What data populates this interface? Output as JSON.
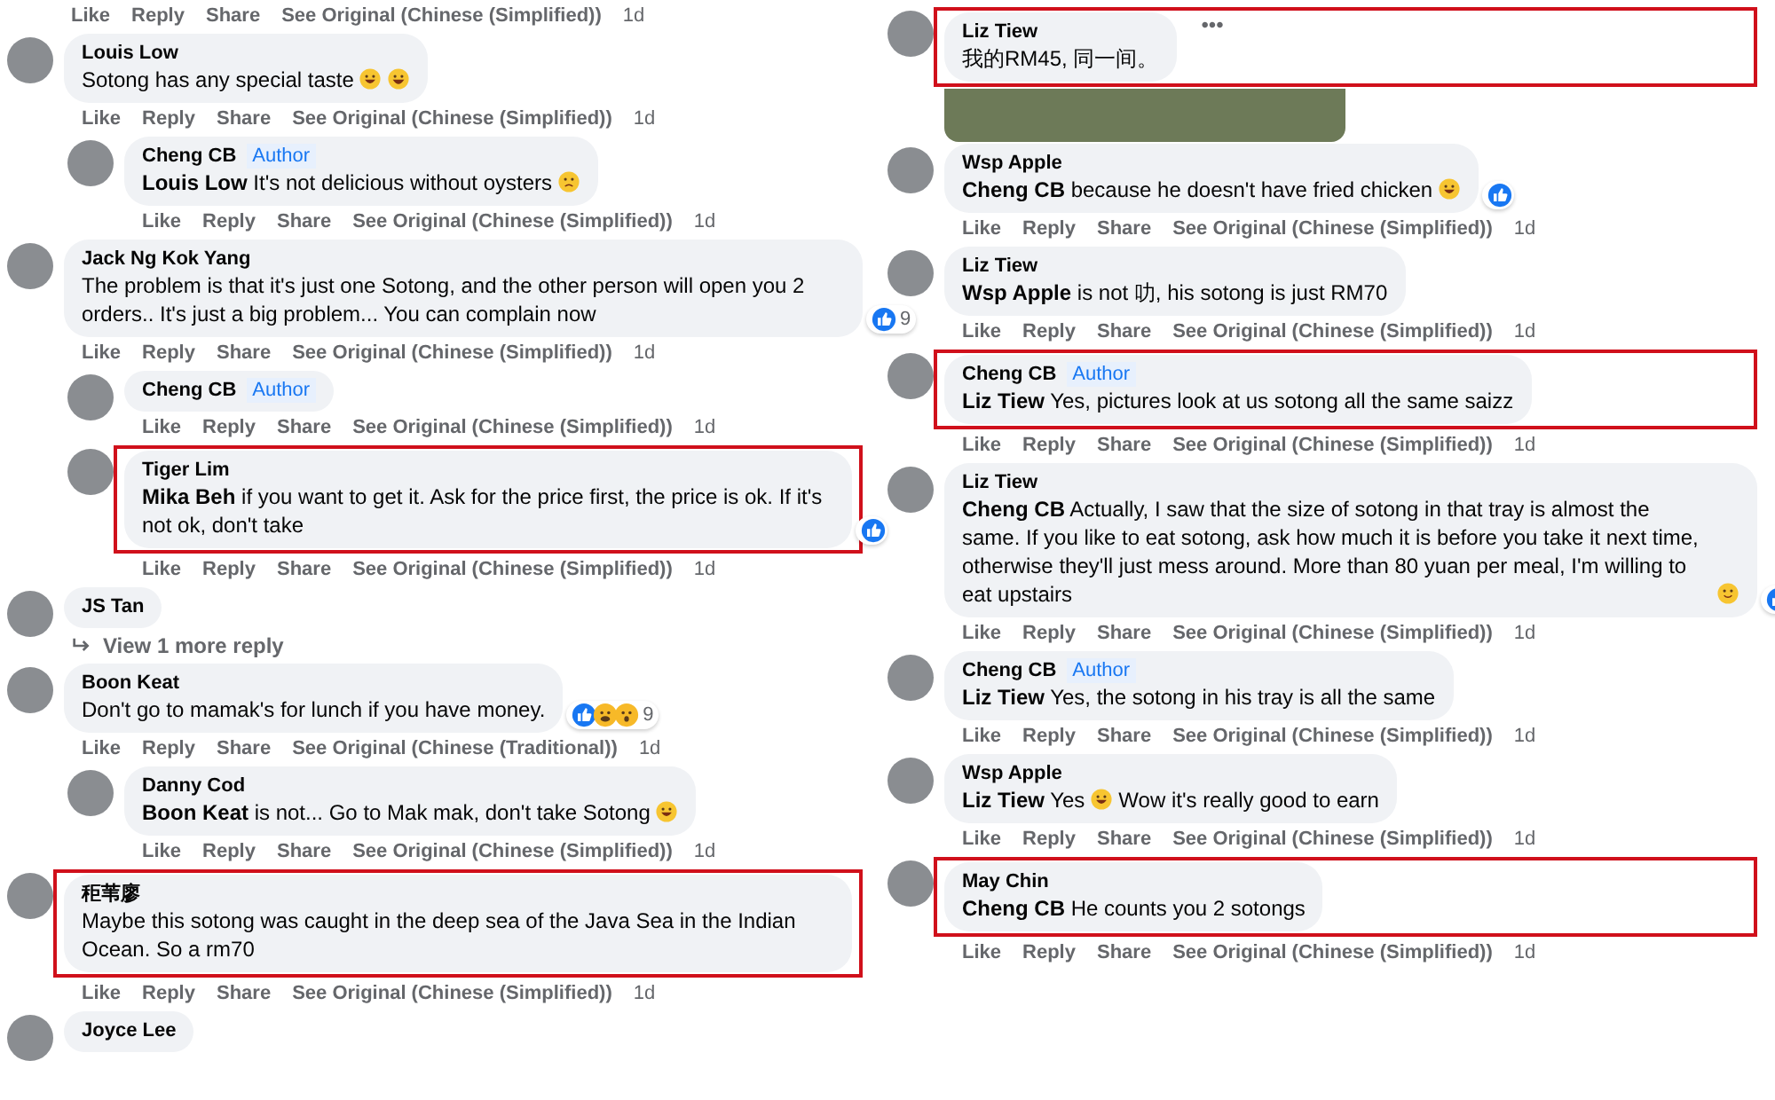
{
  "columns": [
    {
      "items": [
        {
          "kind": "actions",
          "actions": [
            "Like",
            "Reply",
            "Share",
            "See Original (Chinese (Simplified))",
            "1d"
          ]
        },
        {
          "kind": "comment",
          "name": "Louis Low",
          "text": "Sotong has any special taste",
          "emojis": [
            {
              "kind": "laugh"
            },
            {
              "kind": "grin"
            }
          ],
          "highlighted": false,
          "actions": [
            "Like",
            "Reply",
            "Share",
            "See Original (Chinese (Simplified))",
            "1d"
          ],
          "children": [
            {
              "kind": "comment",
              "name": "Cheng CB",
              "author": "Author",
              "text": "**Louis Low** It's not delicious without oysters",
              "emojis": [
                {
                  "kind": "sad"
                }
              ],
              "highlighted": false,
              "actions": [
                "Like",
                "Reply",
                "Share",
                "See Original (Chinese (Simplified))",
                "1d"
              ]
            }
          ]
        },
        {
          "kind": "comment",
          "name": "Jack Ng Kok Yang",
          "text": "The problem is that it's just one Sotong, and the other person will open you 2 orders.. It's just a big problem... You can complain now",
          "highlighted": false,
          "reactions": {
            "icons": [
              {
                "kind": "like"
              }
            ],
            "count": "9"
          },
          "actions": [
            "Like",
            "Reply",
            "Share",
            "See Original (Chinese (Simplified))",
            "1d"
          ],
          "children": [
            {
              "kind": "comment",
              "name": "Cheng CB",
              "author": "Author",
              "highlighted": false,
              "actions": [
                "Like",
                "Reply",
                "Share",
                "See Original (Chinese (Simplified))",
                "1d"
              ]
            },
            {
              "kind": "comment",
              "name": "Tiger Lim",
              "text": "**Mika Beh** if you want to get it. Ask for the price first, the price is ok. If it's not ok, don't take",
              "highlighted": true,
              "reactions": {
                "icons": [
                  {
                    "kind": "like"
                  }
                ]
              },
              "actions": [
                "Like",
                "Reply",
                "Share",
                "See Original (Chinese (Simplified))",
                "1d"
              ]
            }
          ]
        },
        {
          "kind": "comment",
          "name": "JS Tan",
          "highlighted": false,
          "more_link": "View 1 more reply"
        },
        {
          "kind": "comment",
          "name": "Boon Keat",
          "text": "Don't go to mamak's for lunch if you have money.",
          "highlighted": false,
          "reactions": {
            "icons": [
              {
                "kind": "like"
              },
              {
                "kind": "haha"
              },
              {
                "kind": "wow"
              }
            ],
            "count": "9"
          },
          "actions": [
            "Like",
            "Reply",
            "Share",
            "See Original (Chinese (Traditional))",
            "1d"
          ],
          "children": [
            {
              "kind": "comment",
              "name": "Danny Cod",
              "text": "**Boon Keat** is not... Go to Mak mak, don't take Sotong",
              "emojis": [
                {
                  "kind": "laugh"
                }
              ],
              "highlighted": false,
              "actions": [
                "Like",
                "Reply",
                "Share",
                "See Original (Chinese (Simplified))",
                "1d"
              ]
            }
          ]
        },
        {
          "kind": "comment",
          "name": "秬苇廖",
          "text": "Maybe this sotong was caught in the deep sea of the Java Sea in the Indian Ocean. So a rm70",
          "highlighted": true,
          "actions": [
            "Like",
            "Reply",
            "Share",
            "See Original (Chinese (Simplified))",
            "1d"
          ]
        },
        {
          "kind": "comment",
          "name": "Joyce Lee",
          "highlighted": false
        }
      ]
    },
    {
      "items": [
        {
          "kind": "comment",
          "name": "Liz Tiew",
          "text": "我的RM45, 同一间。",
          "more": "•••",
          "highlighted": true,
          "photo": true
        },
        {
          "kind": "comment",
          "name": "Wsp Apple",
          "text": "**Cheng CB** because he doesn't have fried chicken",
          "emojis": [
            {
              "kind": "laugh"
            }
          ],
          "highlighted": false,
          "reactions": {
            "icons": [
              {
                "kind": "like"
              }
            ]
          },
          "actions": [
            "Like",
            "Reply",
            "Share",
            "See Original (Chinese (Simplified))",
            "1d"
          ]
        },
        {
          "kind": "comment",
          "name": "Liz Tiew",
          "text": "**Wsp Apple** is not 叻, his sotong is just RM70",
          "highlighted": false,
          "actions": [
            "Like",
            "Reply",
            "Share",
            "See Original (Chinese (Simplified))",
            "1d"
          ]
        },
        {
          "kind": "comment",
          "name": "Cheng CB",
          "author": "Author",
          "text": "**Liz Tiew** Yes, pictures look at us sotong all the same saizz",
          "highlighted": true,
          "actions": [
            "Like",
            "Reply",
            "Share",
            "See Original (Chinese (Simplified))",
            "1d"
          ]
        },
        {
          "kind": "comment",
          "name": "Liz Tiew",
          "text": "**Cheng CB** Actually, I saw that the size of sotong in that tray is almost the same. If you like to eat sotong, ask how much it is before you take it next time, otherwise they'll just mess around. More than 80 yuan per meal, I'm willing to eat upstairs",
          "emojis": [
            {
              "kind": "smile"
            }
          ],
          "highlighted": false,
          "reactions": {
            "icons": [
              {
                "kind": "like"
              }
            ]
          },
          "actions": [
            "Like",
            "Reply",
            "Share",
            "See Original (Chinese (Simplified))",
            "1d"
          ]
        },
        {
          "kind": "comment",
          "name": "Cheng CB",
          "author": "Author",
          "text": "**Liz Tiew** Yes, the sotong in his tray is all the same",
          "highlighted": false,
          "actions": [
            "Like",
            "Reply",
            "Share",
            "See Original (Chinese (Simplified))",
            "1d"
          ]
        },
        {
          "kind": "comment",
          "name": "Wsp Apple",
          "text": "**Liz Tiew** Yes",
          "emojis": [
            {
              "kind": "laugh"
            }
          ],
          "text_after": "Wow it's really good to earn",
          "highlighted": false,
          "actions": [
            "Like",
            "Reply",
            "Share",
            "See Original (Chinese (Simplified))",
            "1d"
          ]
        },
        {
          "kind": "comment",
          "name": "May Chin",
          "text": "**Cheng CB** He counts you 2 sotongs",
          "highlighted": true,
          "actions": [
            "Like",
            "Reply",
            "Share",
            "See Original (Chinese (Simplified))",
            "1d"
          ]
        }
      ]
    }
  ]
}
